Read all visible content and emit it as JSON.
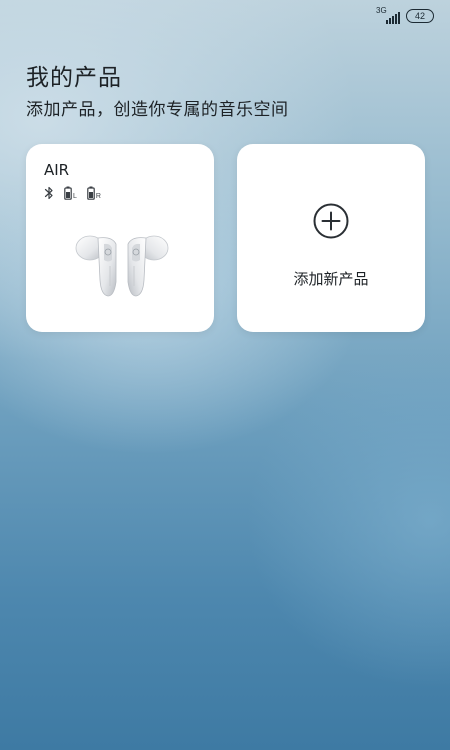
{
  "status_bar": {
    "network_label": "3G",
    "battery_level": "42"
  },
  "header": {
    "title": "我的产品",
    "subtitle": "添加产品，创造你专属的音乐空间"
  },
  "products": [
    {
      "name": "AIR",
      "icons": [
        "bluetooth-icon",
        "left-battery-icon",
        "right-battery-icon"
      ],
      "left_label": "L",
      "right_label": "R"
    }
  ],
  "add_card": {
    "icon": "plus-circle-icon",
    "label": "添加新产品"
  }
}
